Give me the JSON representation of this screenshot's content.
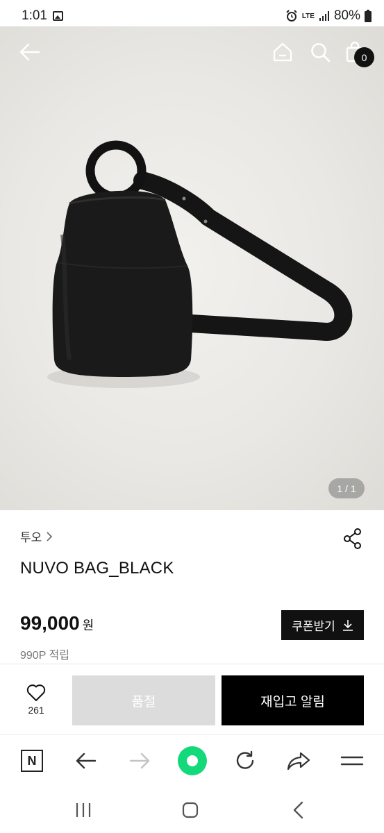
{
  "status_bar": {
    "time": "1:01",
    "network": "LTE",
    "battery": "80%"
  },
  "header": {
    "cart_count": "0"
  },
  "hero": {
    "image_counter": "1 / 1"
  },
  "product": {
    "brand": "투오",
    "name": "NUVO BAG_BLACK",
    "price": "99,000",
    "price_unit": "원",
    "points": "990P 적립",
    "coupon_label": "쿠폰받기"
  },
  "actions": {
    "like_count": "261",
    "soldout_label": "품절",
    "restock_label": "재입고 알림"
  },
  "browser_toolbar": {
    "home_letter": "N",
    "accent_color": "#14d97a"
  },
  "colors": {
    "primary": "#111111",
    "soldout_bg": "#dcdcdc",
    "hero_bg": "#e9e8e4"
  }
}
